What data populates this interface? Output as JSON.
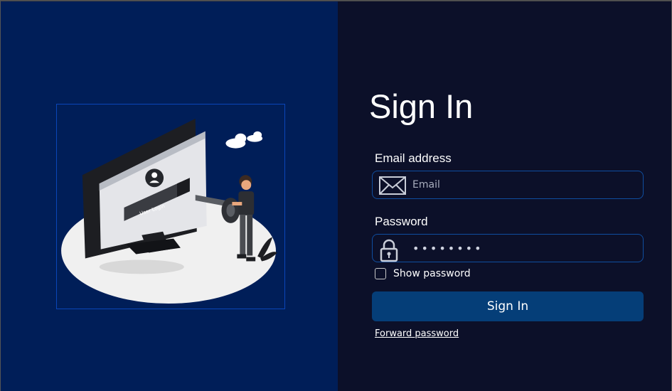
{
  "signin": {
    "title": "Sign In",
    "email": {
      "label": "Email address",
      "placeholder": "Email",
      "icon": "envelope-icon"
    },
    "password": {
      "label": "Password",
      "value": "••••••••",
      "icon": "lock-icon"
    },
    "show_password_label": "Show password",
    "show_password_checked": false,
    "submit_label": "Sign In",
    "forward_password_link": "Forward password"
  },
  "illustration": {
    "monitor_text": "User Login"
  },
  "colors": {
    "left_panel_bg": "#001e58",
    "right_panel_bg": "#0c1029",
    "button_bg": "#053e78",
    "field_border": "#0f4ea0"
  }
}
